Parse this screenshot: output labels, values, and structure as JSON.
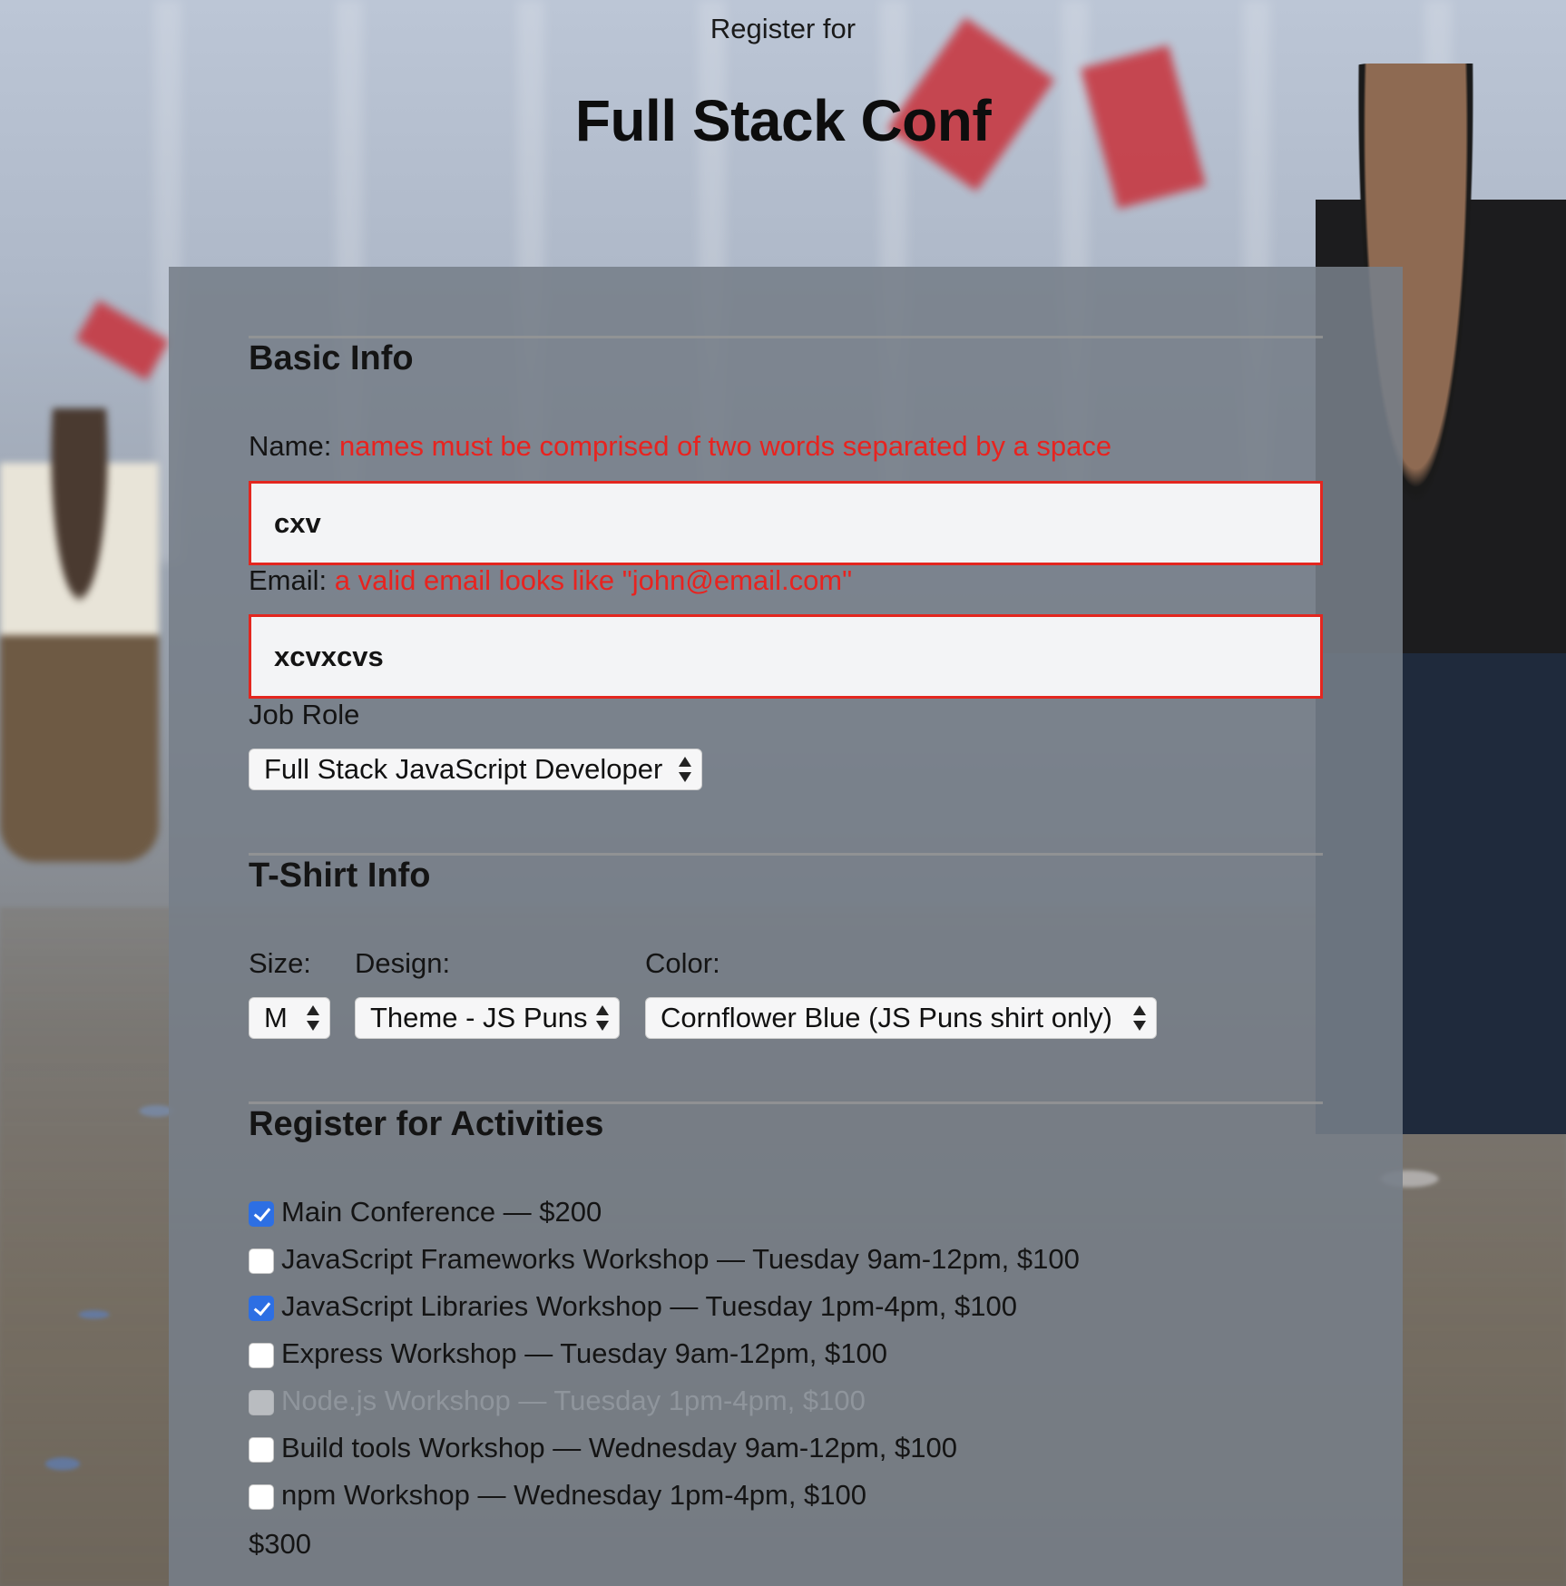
{
  "header": {
    "pre_title": "Register for",
    "title": "Full Stack Conf"
  },
  "basic_info": {
    "heading": "Basic Info",
    "name_label": "Name:",
    "name_error": "names must be comprised of two words separated by a space",
    "name_value": "cxv",
    "email_label": "Email:",
    "email_error": "a valid email looks like \"john@email.com\"",
    "email_value": "xcvxcvs",
    "job_role_label": "Job Role",
    "job_role_selected": "Full Stack JavaScript Developer"
  },
  "tshirt_info": {
    "heading": "T-Shirt Info",
    "size_label": "Size:",
    "size_selected": "M",
    "design_label": "Design:",
    "design_selected": "Theme - JS Puns",
    "color_label": "Color:",
    "color_selected": "Cornflower Blue (JS Puns shirt only)"
  },
  "activities": {
    "heading": "Register for Activities",
    "items": [
      {
        "label": "Main Conference — $200",
        "checked": true,
        "disabled": false
      },
      {
        "label": "JavaScript Frameworks Workshop — Tuesday 9am-12pm, $100",
        "checked": false,
        "disabled": false
      },
      {
        "label": "JavaScript Libraries Workshop — Tuesday 1pm-4pm, $100",
        "checked": true,
        "disabled": false
      },
      {
        "label": "Express Workshop — Tuesday 9am-12pm, $100",
        "checked": false,
        "disabled": false
      },
      {
        "label": "Node.js Workshop — Tuesday 1pm-4pm, $100",
        "checked": false,
        "disabled": true
      },
      {
        "label": "Build tools Workshop — Wednesday 9am-12pm, $100",
        "checked": false,
        "disabled": false
      },
      {
        "label": "npm Workshop — Wednesday 1pm-4pm, $100",
        "checked": false,
        "disabled": false
      }
    ],
    "total": "$300"
  },
  "colors": {
    "error": "#e8231f",
    "checkbox_checked": "#2d6fe3",
    "panel": "#767e89"
  }
}
